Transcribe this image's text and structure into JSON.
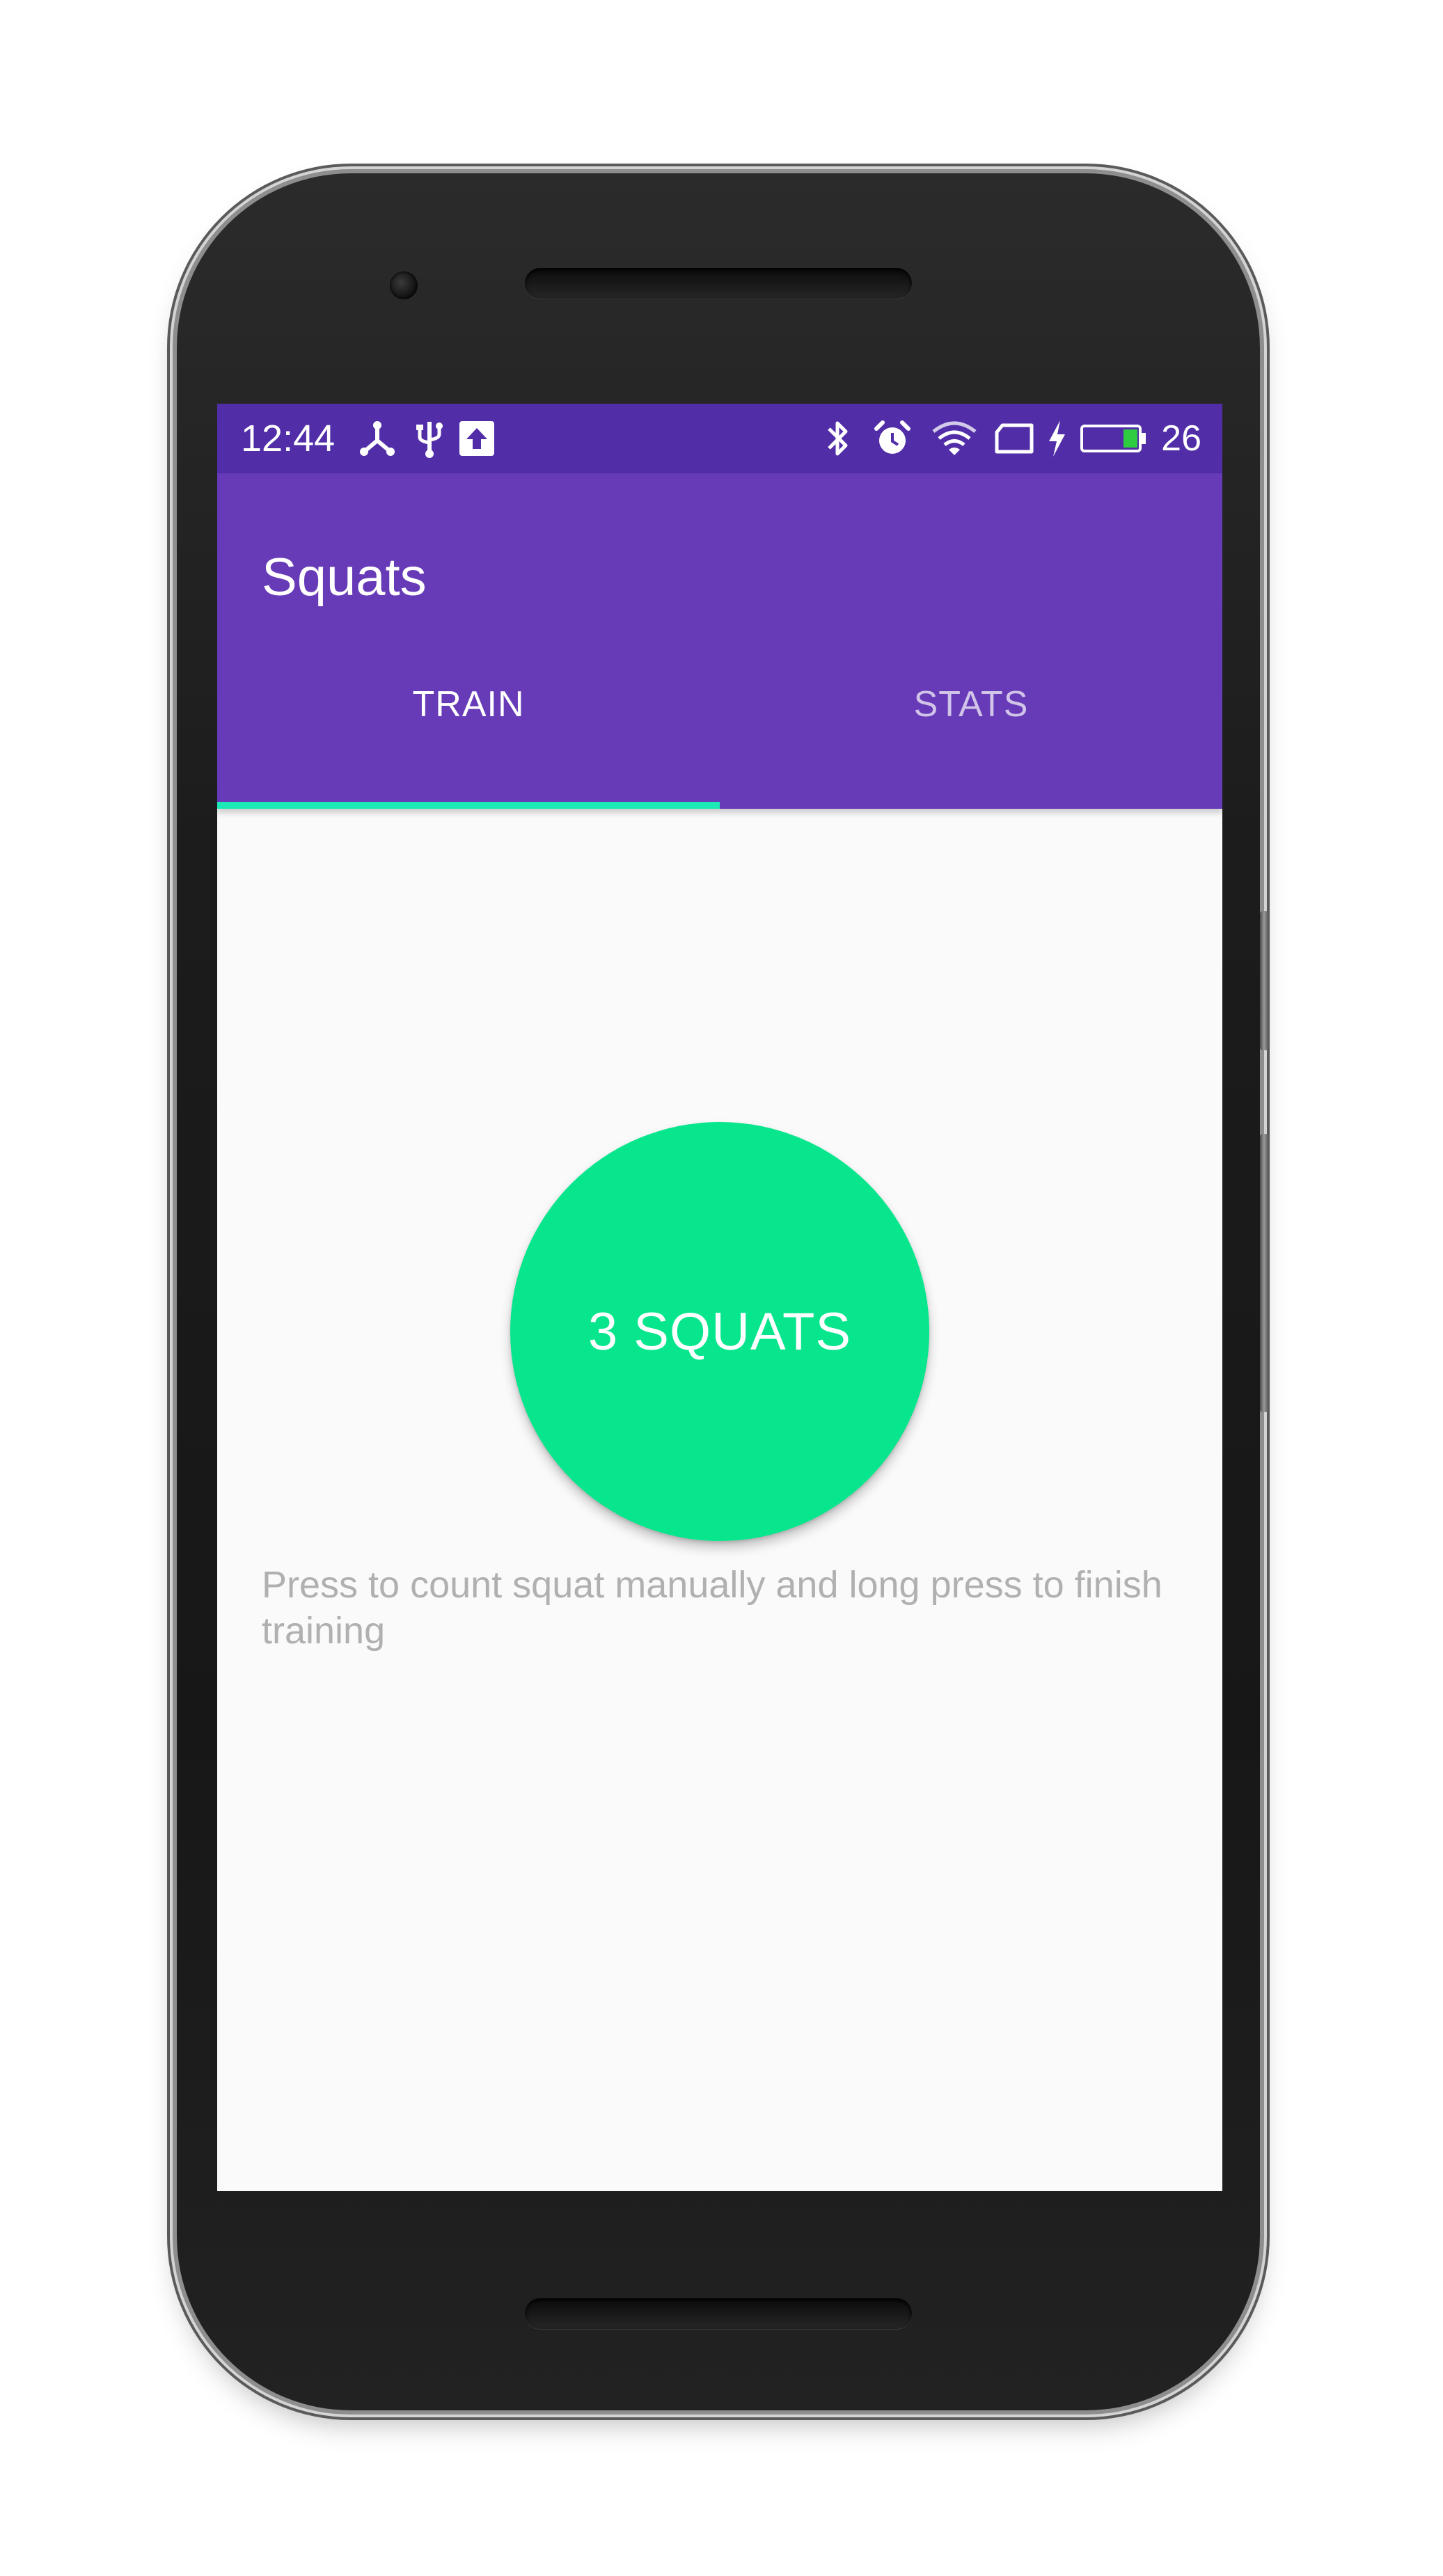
{
  "status_bar": {
    "time": "12:44",
    "left_icons": [
      "usb-debug-icon",
      "usb-icon",
      "upload-icon"
    ],
    "right_icons": [
      "bluetooth-icon",
      "alarm-icon",
      "wifi-icon",
      "cast-icon",
      "charging-icon",
      "battery-icon"
    ],
    "battery_level": "26",
    "battery_fill_color": "#2ecc40"
  },
  "app_bar": {
    "title": "Squats",
    "background_color": "#673ab7",
    "status_color": "#512da8"
  },
  "tabs": [
    {
      "label": "TRAIN",
      "selected": true
    },
    {
      "label": "STATS",
      "selected": false
    }
  ],
  "tab_indicator_color": "#1de9b6",
  "train": {
    "button_label": "3 SQUATS",
    "button_color": "#07e68d",
    "hint": "Press to count squat manually and long press to finish training"
  }
}
